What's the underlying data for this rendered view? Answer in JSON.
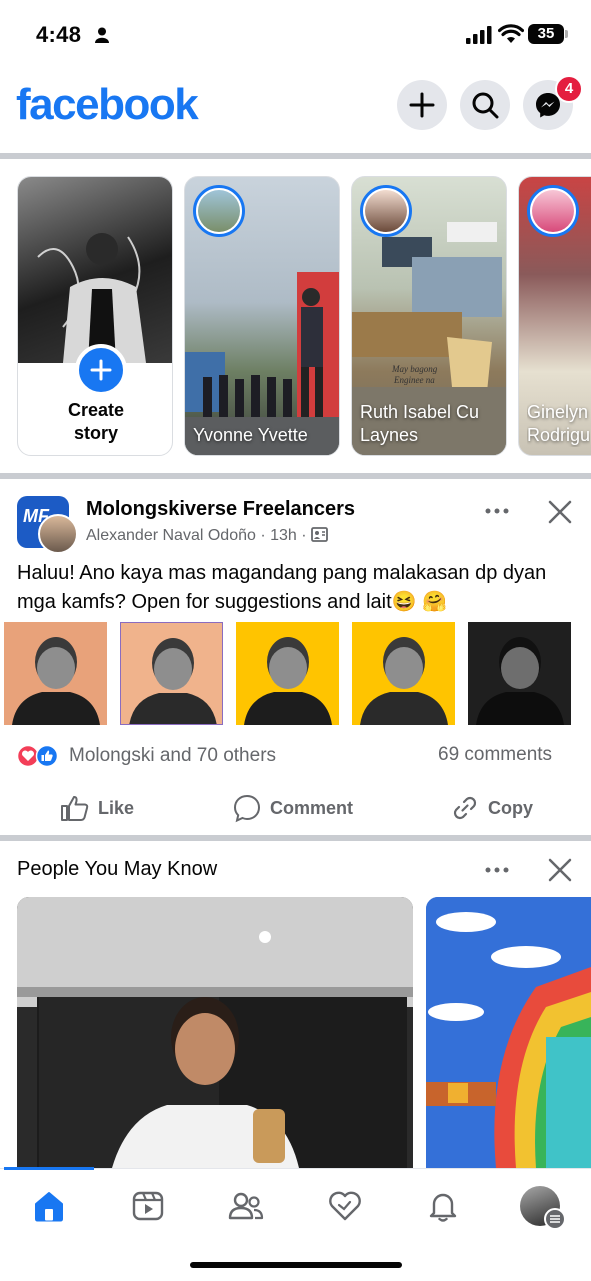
{
  "status_bar": {
    "time": "4:48",
    "battery": "35"
  },
  "header": {
    "logo": "facebook",
    "messenger_badge": "4"
  },
  "stories": [
    {
      "label": "Create\nstory"
    },
    {
      "label": "Yvonne Yvette"
    },
    {
      "label": "Ruth Isabel Cu\nLaynes"
    },
    {
      "label": "Ginelyn\nRodrigu"
    }
  ],
  "post": {
    "group_name": "Molongskiverse Freelancers",
    "author": "Alexander Naval Odoño",
    "time": "13h",
    "text": "Haluu! Ano kaya mas magandang pang malakasan dp dyan mga kamfs? Open for suggestions and lait😆 🤗",
    "reactions_text": "Molongski and 70 others",
    "comments_text": "69 comments",
    "actions": {
      "like": "Like",
      "comment": "Comment",
      "copy": "Copy"
    },
    "photo_backgrounds": [
      "#e8a27a",
      "#f0b38c",
      "#ffc400",
      "#ffc400",
      "#1f1f1f"
    ]
  },
  "pymk": {
    "title": "People You May Know"
  },
  "colors": {
    "brand": "#1877f2",
    "badge": "#e41e3f",
    "muted": "#65676b"
  }
}
